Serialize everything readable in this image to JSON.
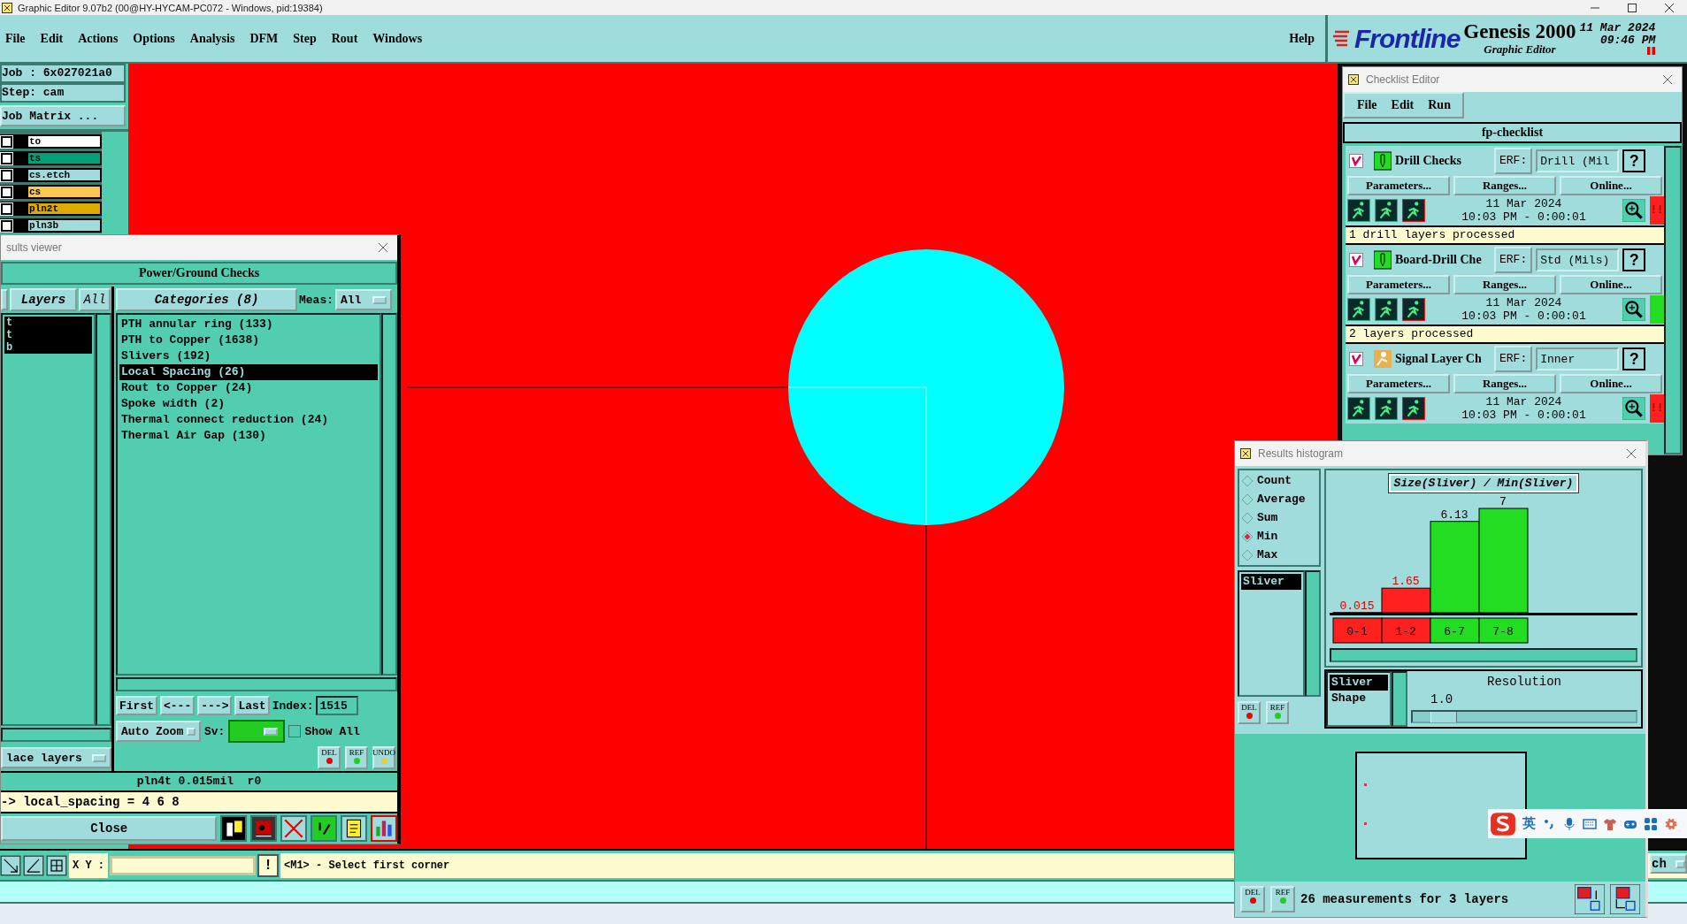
{
  "window": {
    "title": "Graphic Editor 9.07b2 (00@HY-HYCAM-PC072 - Windows, pid:19384)"
  },
  "menu": [
    "File",
    "Edit",
    "Actions",
    "Options",
    "Analysis",
    "DFM",
    "Step",
    "Rout",
    "Windows"
  ],
  "help": "Help",
  "brand": {
    "logo": "Frontline",
    "product": "Genesis 2000",
    "subtitle": "Graphic Editor",
    "date": "11 Mar 2024",
    "time": "09:46 PM"
  },
  "job": {
    "job": "Job :  6x027021a0",
    "step": "Step: cam",
    "matrix": "Job Matrix ..."
  },
  "layers": [
    {
      "name": "to",
      "color": "#ffffff",
      "checked": false
    },
    {
      "name": "ts",
      "color": "#00a07a",
      "checked": false
    },
    {
      "name": "cs.etch",
      "color": "#a0dcdc",
      "checked": false
    },
    {
      "name": "cs",
      "color": "#fcc850",
      "checked": false
    },
    {
      "name": "pln2t",
      "color": "#dcaa00",
      "checked": false
    },
    {
      "name": "pln3b",
      "color": "#a0dcdc",
      "checked": false
    }
  ],
  "results_viewer": {
    "title": "sults viewer",
    "heading": "Power/Ground Checks",
    "layers_label": "Layers",
    "all_label": "All",
    "layer_items": [
      {
        "label": "t",
        "selected": true
      },
      {
        "label": "t",
        "selected": true
      },
      {
        "label": "b",
        "selected": true
      }
    ],
    "categories_label": "Categories (8)",
    "meas_label": "Meas:",
    "meas_value": "All",
    "categories": [
      {
        "label": "PTH annular ring (133)",
        "selected": false
      },
      {
        "label": "PTH to Copper (1638)",
        "selected": false
      },
      {
        "label": "Slivers (192)",
        "selected": false
      },
      {
        "label": "Local Spacing (26)",
        "selected": true
      },
      {
        "label": "Rout to Copper (24)",
        "selected": false
      },
      {
        "label": "Spoke width (2)",
        "selected": false
      },
      {
        "label": "Thermal connect reduction (24)",
        "selected": false
      },
      {
        "label": "Thermal Air Gap (130)",
        "selected": false
      }
    ],
    "nav": [
      "First",
      "<---",
      "--->",
      "Last"
    ],
    "index_label": "Index:",
    "index_value": "1515",
    "zoom_mode": "Auto Zoom",
    "sv_label": "Sv:",
    "show_all": {
      "label": "Show All",
      "checked": false
    },
    "layer_mode": "lace layers",
    "tools": [
      "DEL",
      "REF",
      "UNDO"
    ],
    "info": "pln4t 0.015mil  r0",
    "message": "-> local_spacing = 4 6 8",
    "close": "Close"
  },
  "checklist": {
    "title": "Checklist Editor",
    "menu": [
      "File",
      "Edit",
      "Run"
    ],
    "name": "fp-checklist",
    "actions": [
      {
        "kind": "drill",
        "checked": true,
        "name": "Drill Checks",
        "erf_label": "ERF:",
        "erf": "Drill (Mil",
        "help": "?",
        "buttons": [
          "Parameters...",
          "Ranges...",
          "Online..."
        ],
        "date": "11 Mar 2024",
        "time": "10:03 PM - 0:00:01",
        "color": "#ff2020",
        "status_mark": "!!",
        "message": "1 drill layers processed"
      },
      {
        "kind": "drill",
        "checked": true,
        "name": "Board-Drill Che",
        "erf_label": "ERF:",
        "erf": "Std (Mils)",
        "help": "?",
        "buttons": [
          "Parameters...",
          "Ranges...",
          "Online..."
        ],
        "date": "11 Mar 2024",
        "time": "10:03 PM - 0:00:01",
        "color": "#22dd22",
        "message": "2 layers processed"
      },
      {
        "kind": "signal",
        "checked": true,
        "name": "Signal Layer Ch",
        "erf_label": "ERF:",
        "erf": "Inner",
        "help": "?",
        "buttons": [
          "Parameters...",
          "Ranges...",
          "Online..."
        ],
        "date": "11 Mar 2024",
        "time": "10:03 PM - 0:00:01",
        "color": "#ff2020",
        "status_mark": "!!"
      }
    ]
  },
  "histogram": {
    "title": "Results histogram",
    "modes": [
      {
        "label": "Count",
        "selected": false
      },
      {
        "label": "Average",
        "selected": false
      },
      {
        "label": "Sum",
        "selected": false
      },
      {
        "label": "Min",
        "selected": true
      },
      {
        "label": "Max",
        "selected": false
      }
    ],
    "list": [
      {
        "label": "Sliver",
        "selected": true
      }
    ],
    "tools": [
      "DEL",
      "REF"
    ],
    "chart_title": "Size(Sliver) / Min(Sliver)",
    "chart_data": {
      "type": "bar",
      "categories": [
        "0-1",
        "1-2",
        "6-7",
        "7-8"
      ],
      "values": [
        0.015,
        1.65,
        6.13,
        7
      ],
      "data_labels": true
    },
    "bins": [
      {
        "passed": false
      },
      {
        "passed": false
      },
      {
        "passed": true
      },
      {
        "passed": true
      }
    ],
    "attributes": [
      {
        "label": "Sliver",
        "selected": true
      },
      {
        "label": "Shape",
        "selected": false
      }
    ],
    "resolution_label": "Resolution",
    "resolution_value": "1.0",
    "resolution": {
      "level": 0.08
    },
    "summary": "26 measurements for 3 layers",
    "footer_tools": [
      "DEL",
      "REF"
    ]
  },
  "command_bar": {
    "xy_label": "X Y :",
    "alert": "!",
    "prompt": "<M1> - Select first corner"
  },
  "ime": {
    "lang": "英"
  },
  "side_dropdown": "ch"
}
